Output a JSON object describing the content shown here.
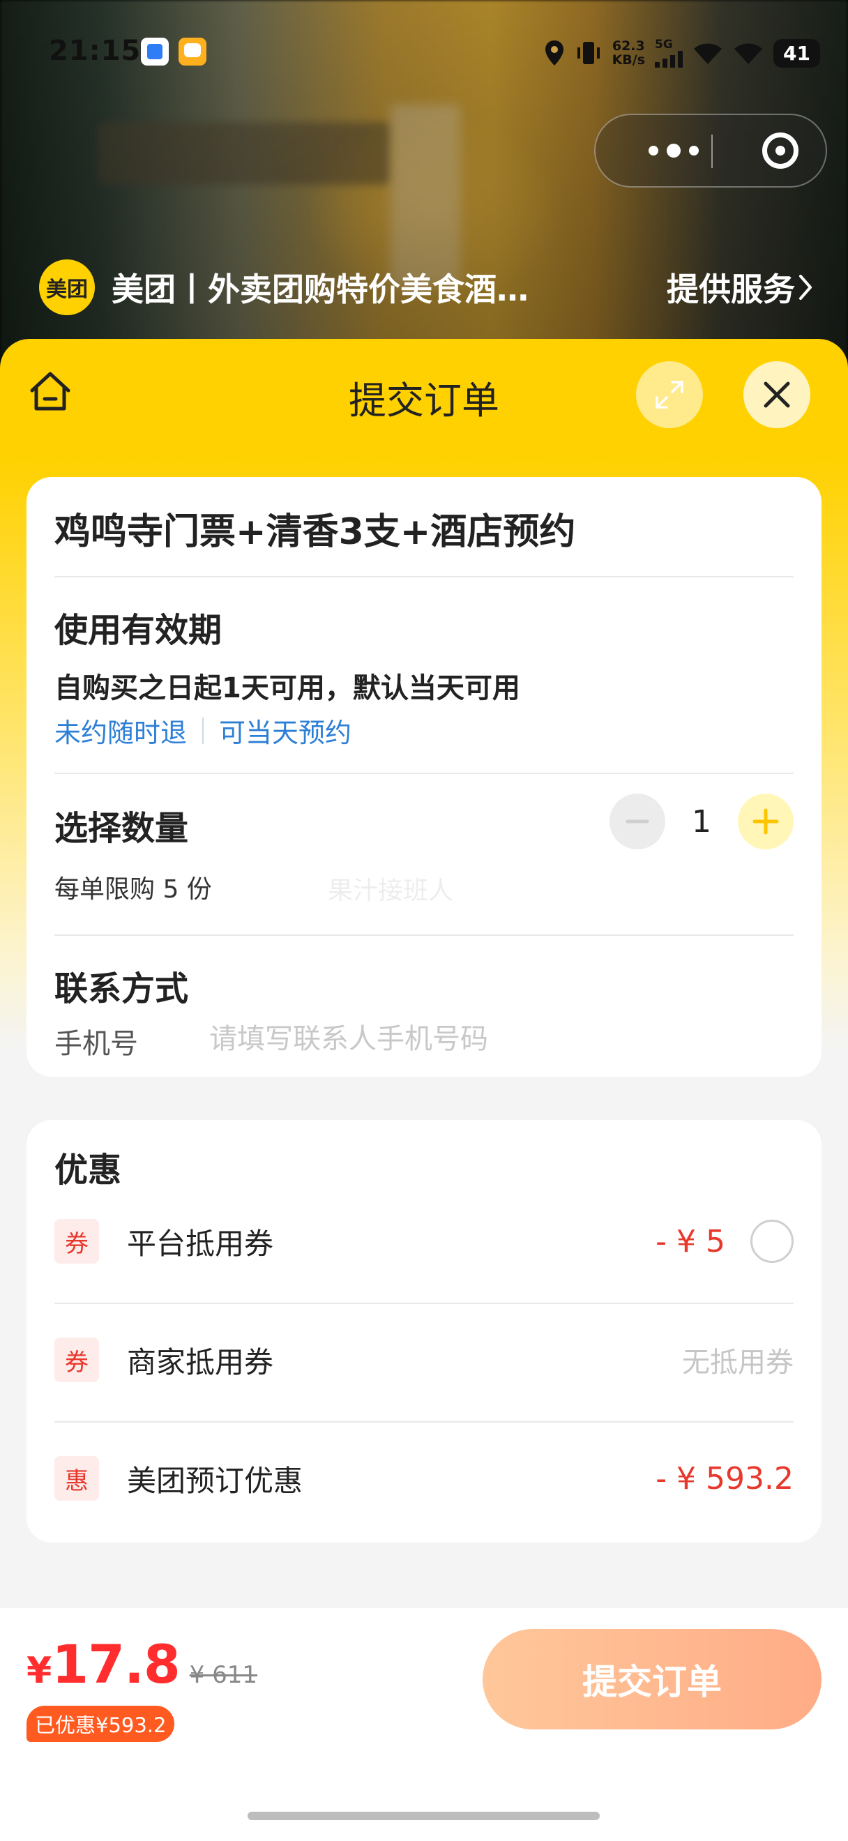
{
  "status_bar": {
    "time": "21:15",
    "net_speed_value": "62.3",
    "net_speed_unit": "KB/s",
    "network": "5G",
    "battery": "41"
  },
  "mini_program": {
    "logo_text": "美团",
    "title": "美团丨外卖团购特价美食酒…",
    "service_label": "提供服务"
  },
  "sheet": {
    "title": "提交订单"
  },
  "product": {
    "title": "鸡鸣寺门票+清香3支+酒店预约",
    "validity_heading": "使用有效期",
    "validity_text": "自购买之日起1天可用，默认当天可用",
    "tags": [
      "未约随时退",
      "可当天预约"
    ],
    "quantity_heading": "选择数量",
    "quantity_value": "1",
    "quantity_limit": "每单限购 5 份",
    "contact_heading": "联系方式",
    "phone_label": "手机号",
    "phone_value": "",
    "phone_placeholder": "请填写联系人手机号码"
  },
  "watermark": "果汁接班人",
  "discounts": {
    "heading": "优惠",
    "items": [
      {
        "badge": "券",
        "label": "平台抵用券",
        "value": "- ¥ 5",
        "selected": false
      },
      {
        "badge": "券",
        "label": "商家抵用券",
        "value": "无抵用券"
      },
      {
        "badge": "惠",
        "label": "美团预订优惠",
        "value": "- ¥ 593.2"
      }
    ]
  },
  "footer": {
    "currency": "¥",
    "price": "17.8",
    "original_price": "¥ 611",
    "saved_label": "已优惠¥593.2",
    "submit_label": "提交订单"
  },
  "colors": {
    "brand_yellow": "#ffd100",
    "price_red": "#ff2d2d",
    "link_blue": "#2d7fd6",
    "submit_gradient_start": "#ffc79a",
    "submit_gradient_end": "#ffac86"
  }
}
